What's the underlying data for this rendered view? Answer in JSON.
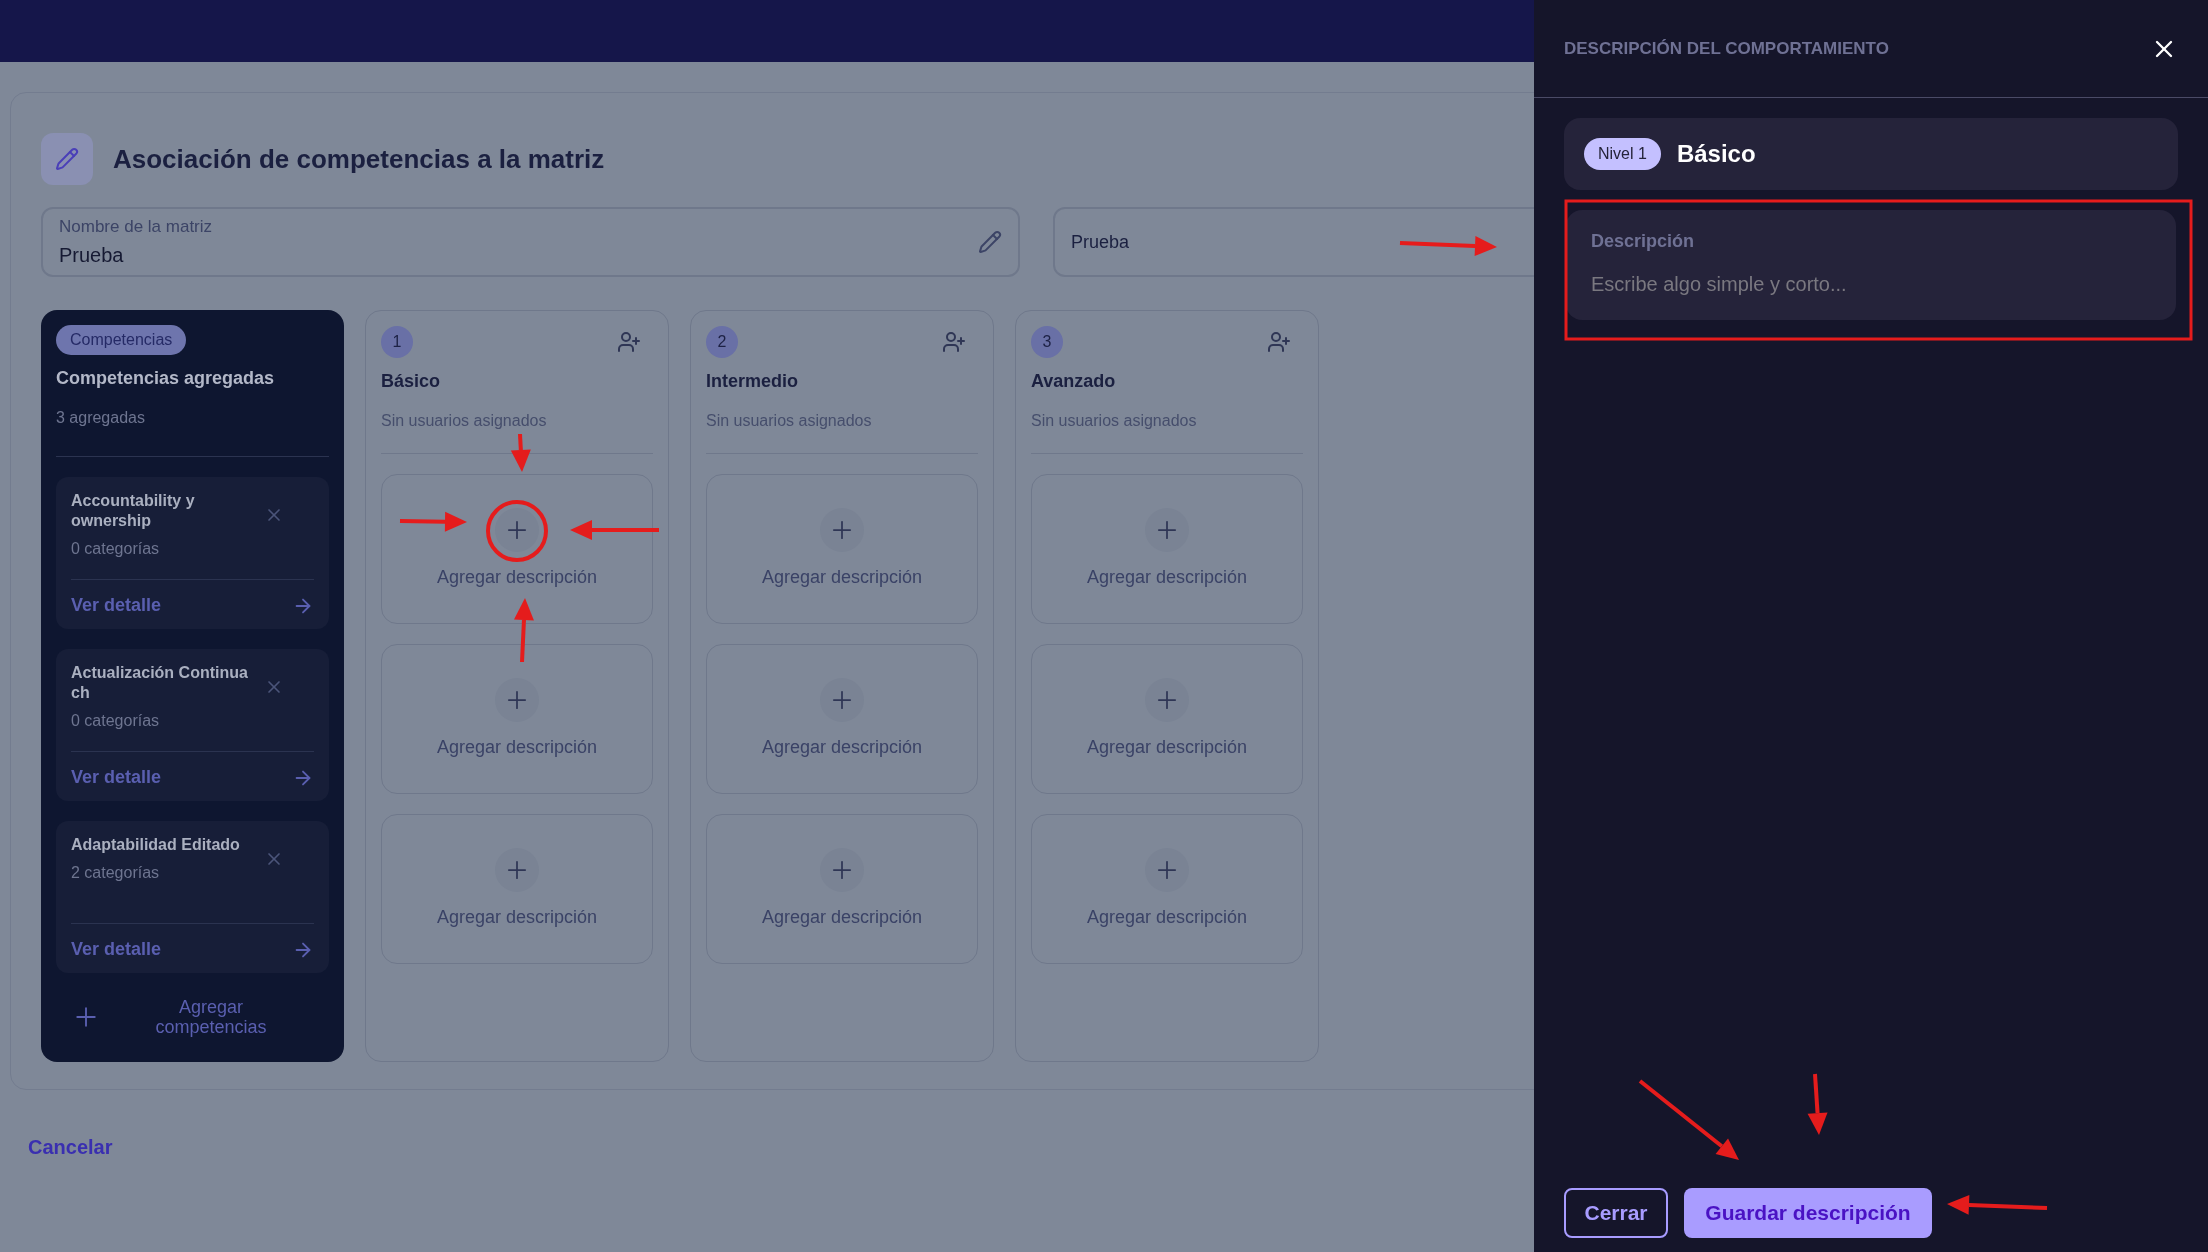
{
  "page": {
    "title": "Asociación de competencias a la matriz",
    "name_field": {
      "label": "Nombre de la matriz",
      "value": "Prueba"
    },
    "second_field": {
      "value": "Prueba"
    },
    "competencies": {
      "badge": "Competencias",
      "title": "Competencias agregadas",
      "count": "3 agregadas",
      "items": [
        {
          "name": "Accountability y ownership",
          "categories": "0 categorías",
          "link": "Ver detalle"
        },
        {
          "name": "Actualización Continua ch",
          "categories": "0 categorías",
          "link": "Ver detalle"
        },
        {
          "name": "Adaptabilidad Editado",
          "categories": "2 categorías",
          "link": "Ver detalle"
        }
      ],
      "add_button": "Agregar competencias"
    },
    "levels": [
      {
        "number": "1",
        "name": "Básico",
        "users": "Sin usuarios asignados",
        "slots": [
          "Agregar descripción",
          "Agregar descripción",
          "Agregar descripción"
        ]
      },
      {
        "number": "2",
        "name": "Intermedio",
        "users": "Sin usuarios asignados",
        "slots": [
          "Agregar descripción",
          "Agregar descripción",
          "Agregar descripción"
        ]
      },
      {
        "number": "3",
        "name": "Avanzado",
        "users": "Sin usuarios asignados",
        "slots": [
          "Agregar descripción",
          "Agregar descripción",
          "Agregar descripción"
        ]
      }
    ],
    "cancel": "Cancelar"
  },
  "panel": {
    "title": "DESCRIPCIÓN DEL COMPORTAMIENTO",
    "level_badge": "Nivel 1",
    "level_name": "Básico",
    "description": {
      "label": "Descripción",
      "placeholder": "Escribe algo simple y corto..."
    },
    "buttons": [
      {
        "label": "Cerrar",
        "kind": "secondary"
      },
      {
        "label": "Guardar descripción",
        "kind": "primary"
      }
    ]
  }
}
